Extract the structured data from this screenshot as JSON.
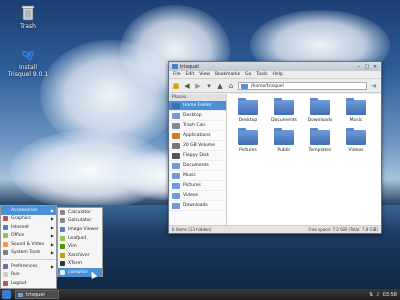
{
  "desktop": {
    "icons": [
      {
        "label": "Trash",
        "icon": "trash-icon"
      },
      {
        "label": "Install\nTrisquel 9.0.1",
        "icon": "install-icon"
      }
    ]
  },
  "window": {
    "title": "trisquel",
    "menu": [
      "File",
      "Edit",
      "View",
      "Bookmarks",
      "Go",
      "Tools",
      "Help"
    ],
    "address": "/home/trisquel",
    "places_header": "Places",
    "places": [
      {
        "label": "Home Folder",
        "selected": true,
        "color": "#3f6fb5"
      },
      {
        "label": "Desktop",
        "selected": false,
        "color": "#6f9bd9"
      },
      {
        "label": "Trash Can",
        "selected": false,
        "color": "#888888"
      },
      {
        "label": "Applications",
        "selected": false,
        "color": "#d07a2a"
      },
      {
        "label": "20 GB Volume",
        "selected": false,
        "color": "#777777"
      },
      {
        "label": "Floppy Disk",
        "selected": false,
        "color": "#555555"
      },
      {
        "label": "Documents",
        "selected": false,
        "color": "#6f9bd9"
      },
      {
        "label": "Music",
        "selected": false,
        "color": "#6f9bd9"
      },
      {
        "label": "Pictures",
        "selected": false,
        "color": "#6f9bd9"
      },
      {
        "label": "Videos",
        "selected": false,
        "color": "#6f9bd9"
      },
      {
        "label": "Downloads",
        "selected": false,
        "color": "#6f9bd9"
      }
    ],
    "files": [
      "Desktop",
      "Documents",
      "Downloads",
      "Music",
      "Pictures",
      "Public",
      "Templates",
      "Videos"
    ],
    "status_left": "8 items (13 hidden)",
    "status_right": "Free space: 7.2 GiB (Total: 7.8 GiB)"
  },
  "start_menu": {
    "items": [
      {
        "label": "Accessories",
        "submenu": true,
        "selected": true,
        "color": "#4a90d9"
      },
      {
        "label": "Graphics",
        "submenu": true,
        "selected": false,
        "color": "#c0504d"
      },
      {
        "label": "Internet",
        "submenu": true,
        "selected": false,
        "color": "#4f81bd"
      },
      {
        "label": "Office",
        "submenu": true,
        "selected": false,
        "color": "#9bbb59"
      },
      {
        "label": "Sound & Video",
        "submenu": true,
        "selected": false,
        "color": "#f79646"
      },
      {
        "label": "System Tools",
        "submenu": true,
        "selected": false,
        "color": "#7f7f7f"
      }
    ],
    "items_bottom": [
      {
        "label": "Preferences",
        "submenu": true,
        "color": "#8064a2"
      },
      {
        "label": "Run",
        "submenu": false,
        "color": "#cccccc"
      },
      {
        "label": "Logout",
        "submenu": false,
        "color": "#c0504d"
      }
    ],
    "submenu": [
      {
        "label": "Calculator",
        "selected": false,
        "color": "#888888"
      },
      {
        "label": "Galculator",
        "selected": false,
        "color": "#888888"
      },
      {
        "label": "Image Viewer",
        "selected": false,
        "color": "#4f81bd"
      },
      {
        "label": "Leafpad",
        "selected": false,
        "color": "#9bbb59"
      },
      {
        "label": "Vim",
        "selected": false,
        "color": "#4e9a06"
      },
      {
        "label": "Xarchiver",
        "selected": false,
        "color": "#c4a000"
      },
      {
        "label": "XTerm",
        "selected": false,
        "color": "#333333"
      },
      {
        "label": "compton",
        "selected": true,
        "color": "#eeeeee"
      }
    ]
  },
  "panel": {
    "task_label": "trisquel",
    "clock": "03:58"
  }
}
